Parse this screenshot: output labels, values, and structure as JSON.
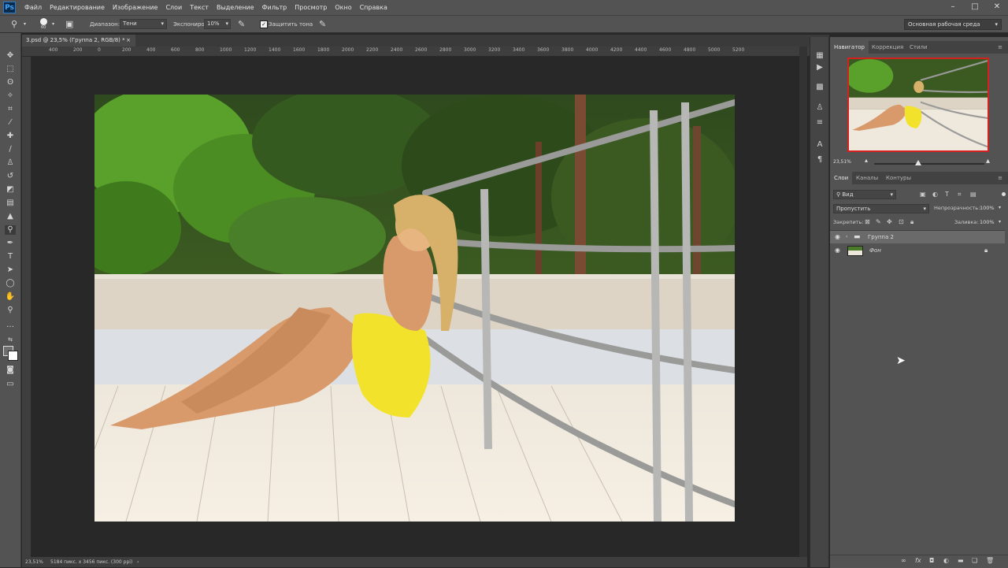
{
  "app": {
    "logo": "Ps"
  },
  "menu": [
    "Файл",
    "Редактирование",
    "Изображение",
    "Слои",
    "Текст",
    "Выделение",
    "Фильтр",
    "Просмотр",
    "Окно",
    "Справка"
  ],
  "window_controls": [
    "–",
    "□",
    "✕"
  ],
  "options": {
    "brush_size": "60",
    "range_label": "Диапазон:",
    "range_value": "Тени",
    "exposure_label": "Экспониро.:",
    "exposure_value": "10%",
    "protect_tones": "Защитить тона",
    "workspace": "Основная рабочая среда"
  },
  "document": {
    "tab_title": "3.psd @ 23,5% (Группа 2, RGB/8) *",
    "close": "×",
    "zoom": "23,51%",
    "info": "5184 пикс. x 3456 пикс. (300 ppi)"
  },
  "ruler_ticks": [
    "400",
    "200",
    "0",
    "200",
    "400",
    "600",
    "800",
    "1000",
    "1200",
    "1400",
    "1600",
    "1800",
    "2000",
    "2200",
    "2400",
    "2600",
    "2800",
    "3000",
    "3200",
    "3400",
    "3600",
    "3800",
    "4000",
    "4200",
    "4400",
    "4600",
    "4800",
    "5000",
    "5200"
  ],
  "navigator": {
    "tabs": [
      "Навигатор",
      "Коррекция",
      "Стили"
    ],
    "zoom": "23,51%"
  },
  "layers_panel": {
    "tabs": [
      "Слои",
      "Каналы",
      "Контуры"
    ],
    "filter": "Вид",
    "blend_mode": "Пропустить",
    "opacity_label": "Непрозрачность:",
    "opacity_value": "100%",
    "lock_label": "Закрепить:",
    "fill_label": "Заливка:",
    "fill_value": "100%",
    "layers": [
      {
        "name": "Группа 2"
      },
      {
        "name": "Фон"
      }
    ]
  },
  "colors": {
    "accent": "#d62020",
    "panel": "#535353",
    "canvas": "#282828"
  }
}
